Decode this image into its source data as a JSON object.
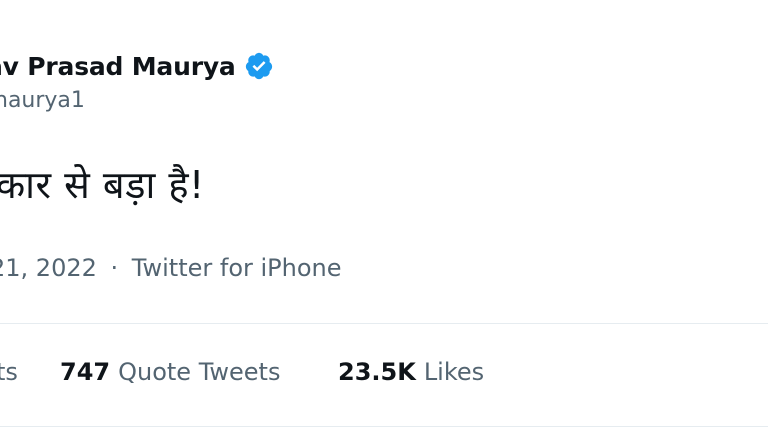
{
  "author": {
    "display_name": "av Prasad Maurya",
    "handle": "naurya1",
    "verified_icon": "verified-badge-icon",
    "verified_color": "#1d9bf0"
  },
  "tweet": {
    "text": "कार से बड़ा है!",
    "date": "21, 2022",
    "separator": "·",
    "source": "Twitter for iPhone"
  },
  "stats": {
    "retweets_label": "ts",
    "quotes_count": "747",
    "quotes_label": "Quote Tweets",
    "likes_count": "23.5K",
    "likes_label": "Likes"
  }
}
